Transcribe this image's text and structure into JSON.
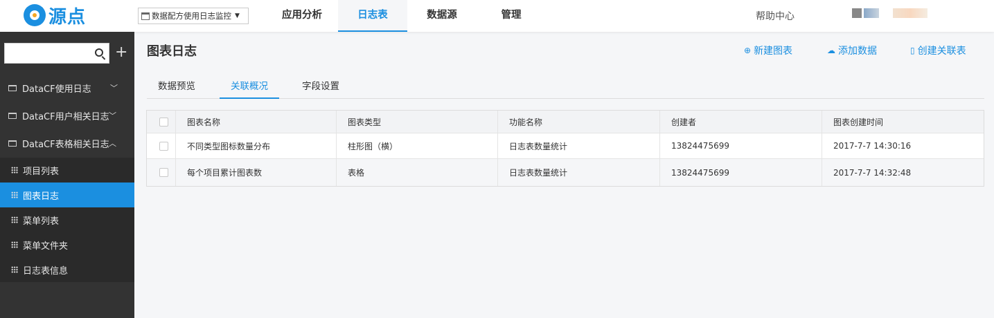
{
  "brand": {
    "name": "源点"
  },
  "project_select": {
    "value": "数据配方使用日志监控"
  },
  "nav": {
    "tabs": [
      {
        "label": "应用分析"
      },
      {
        "label": "日志表"
      },
      {
        "label": "数据源"
      },
      {
        "label": "管理"
      }
    ],
    "help": "帮助中心"
  },
  "sidebar": {
    "search_placeholder": "",
    "groups": [
      {
        "label": "DataCF使用日志"
      },
      {
        "label": "DataCF用户相关日志"
      },
      {
        "label": "DataCF表格相关日志"
      }
    ],
    "items": [
      {
        "label": "项目列表"
      },
      {
        "label": "图表日志"
      },
      {
        "label": "菜单列表"
      },
      {
        "label": "菜单文件夹"
      },
      {
        "label": "日志表信息"
      }
    ]
  },
  "main": {
    "title": "图表日志",
    "actions": [
      {
        "label": "新建图表",
        "icon": "plus-circle-icon"
      },
      {
        "label": "添加数据",
        "icon": "cloud-upload-icon"
      },
      {
        "label": "创建关联表",
        "icon": "document-icon"
      }
    ],
    "tabs": [
      {
        "label": "数据预览"
      },
      {
        "label": "关联概况"
      },
      {
        "label": "字段设置"
      }
    ],
    "table": {
      "headers": [
        "图表名称",
        "图表类型",
        "功能名称",
        "创建者",
        "图表创建时间"
      ],
      "rows": [
        [
          "不同类型图标数量分布",
          "柱形图（横）",
          "日志表数量统计",
          "13824475699",
          "2017-7-7 14:30:16"
        ],
        [
          "每个项目累计图表数",
          "表格",
          "日志表数量统计",
          "13824475699",
          "2017-7-7 14:32:48"
        ]
      ]
    }
  },
  "colors": {
    "accent": "#1b8fe0",
    "sidebar": "#333333",
    "sidebar_sub": "#2a2a2a"
  }
}
